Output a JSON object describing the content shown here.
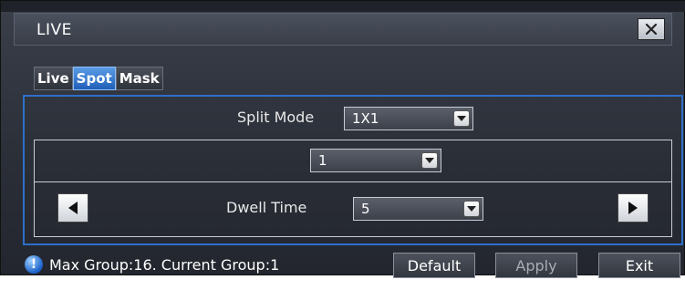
{
  "window": {
    "title": "LIVE"
  },
  "tabs": [
    {
      "label": "Live",
      "active": false
    },
    {
      "label": "Spot",
      "active": true
    },
    {
      "label": "Mask",
      "active": false
    }
  ],
  "split_mode": {
    "label": "Split Mode",
    "value": "1X1"
  },
  "channel": {
    "value": "1"
  },
  "dwell_time": {
    "label": "Dwell Time",
    "value": "5"
  },
  "status": {
    "text": "Max Group:16.  Current Group:1"
  },
  "buttons": {
    "default": "Default",
    "apply": "Apply",
    "exit": "Exit"
  },
  "colors": {
    "accent": "#2f6fc9",
    "tab_active": "#3a7fd8",
    "background": "#2a2e37"
  }
}
